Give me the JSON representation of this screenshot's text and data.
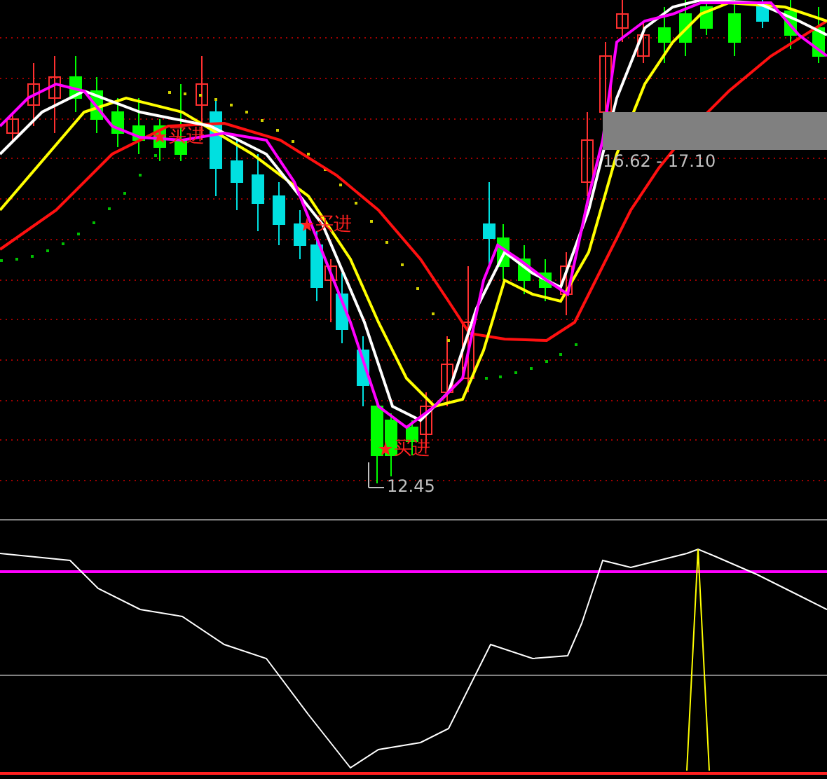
{
  "price_panel": {
    "signals": [
      {
        "label": "买进"
      },
      {
        "label": "买进"
      },
      {
        "label": "买进"
      }
    ],
    "low_label": "12.45",
    "range_label": "16.62 - 17.10"
  }
}
